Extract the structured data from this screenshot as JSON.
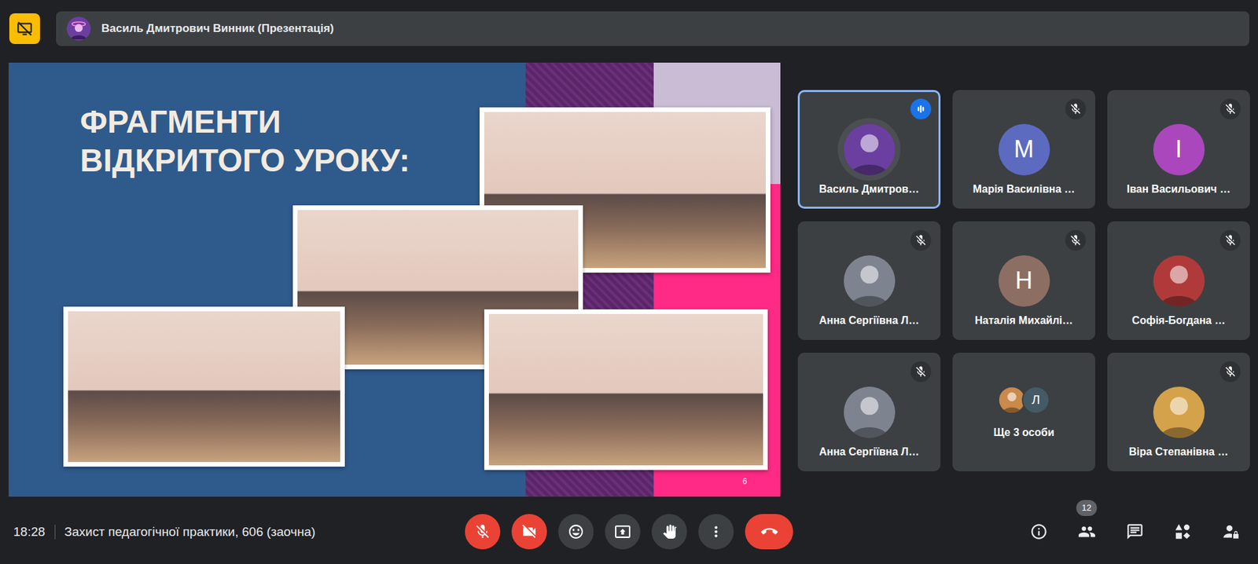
{
  "top_bar": {
    "presenter": "Василь Дмитрович Винник (Презентація)"
  },
  "slide": {
    "title_lines": [
      "ФРАГМЕНТИ",
      "ВІДКРИТОГО УРОКУ:"
    ],
    "page": "6"
  },
  "participants": [
    {
      "kind": "person",
      "name": "Василь Дмитров…",
      "avatar": {
        "kind": "photo",
        "color": "#6b3fa0"
      },
      "muted": false,
      "speaking": true
    },
    {
      "kind": "person",
      "name": "Марія Василівна …",
      "avatar": {
        "kind": "letter",
        "initial": "М",
        "color": "#5c6bc0"
      },
      "muted": true,
      "speaking": false
    },
    {
      "kind": "person",
      "name": "Іван Васильович …",
      "avatar": {
        "kind": "letter",
        "initial": "І",
        "color": "#ab47bc"
      },
      "muted": true,
      "speaking": false
    },
    {
      "kind": "person",
      "name": "Анна Сергіївна Л…",
      "avatar": {
        "kind": "photo",
        "color": "#7d8490"
      },
      "muted": true,
      "speaking": false
    },
    {
      "kind": "person",
      "name": "Наталія Михайлі…",
      "avatar": {
        "kind": "letter",
        "initial": "Н",
        "color": "#8d6e63"
      },
      "muted": true,
      "speaking": false
    },
    {
      "kind": "person",
      "name": "Софія-Богдана …",
      "avatar": {
        "kind": "photo",
        "color": "#b03a3a"
      },
      "muted": true,
      "speaking": false
    },
    {
      "kind": "person",
      "name": "Анна Сергіївна Л…",
      "avatar": {
        "kind": "photo",
        "color": "#7d8490"
      },
      "muted": true,
      "speaking": false
    },
    {
      "kind": "group",
      "label": "Ще 3 особи",
      "avatars": [
        {
          "kind": "photo",
          "color": "#c98a4b"
        },
        {
          "kind": "letter",
          "initial": "Л",
          "color": "#455a64"
        }
      ]
    },
    {
      "kind": "person",
      "name": "Віра Степанівна …",
      "avatar": {
        "kind": "photo",
        "color": "#d4a24a"
      },
      "muted": true,
      "speaking": false
    }
  ],
  "bottom_bar": {
    "time": "18:28",
    "meeting": "Захист педагогічної практики, 606 (заочна)",
    "controls": [
      {
        "kind": "mic",
        "off": true
      },
      {
        "kind": "camera",
        "off": true
      },
      {
        "kind": "emoji",
        "off": false
      },
      {
        "kind": "present",
        "off": false
      },
      {
        "kind": "hand",
        "off": false
      },
      {
        "kind": "more",
        "off": false
      },
      {
        "kind": "leave",
        "off": false
      }
    ],
    "tools": [
      {
        "kind": "info",
        "badge": ""
      },
      {
        "kind": "people",
        "badge": "12"
      },
      {
        "kind": "chat",
        "badge": ""
      },
      {
        "kind": "activities",
        "badge": ""
      },
      {
        "kind": "host",
        "badge": ""
      }
    ]
  }
}
